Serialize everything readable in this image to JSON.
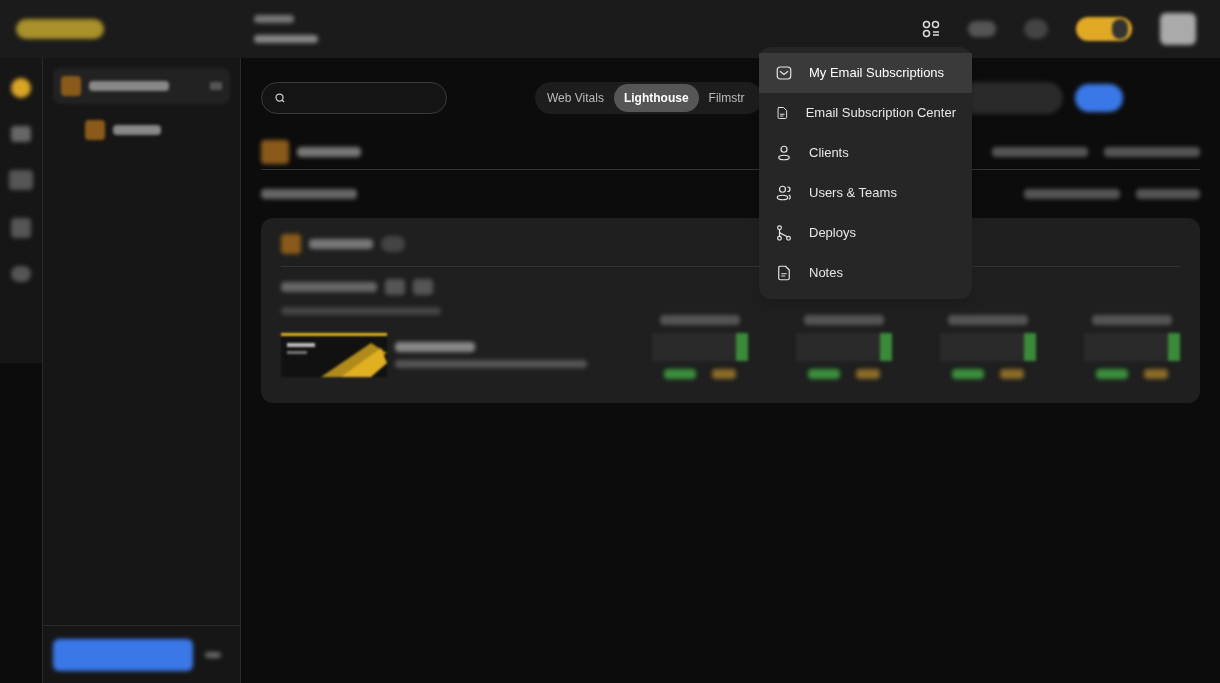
{
  "tabs": [
    {
      "label": "Web Vitals",
      "selected": false
    },
    {
      "label": "Lighthouse",
      "selected": true
    },
    {
      "label": "Filmstr",
      "selected": false
    }
  ],
  "theme_toggle": {
    "on": true
  },
  "menu": {
    "items": [
      {
        "label": "My Email Subscriptions",
        "kind": "mail",
        "selected": true
      },
      {
        "label": "Email Subscription Center",
        "kind": "doc",
        "selected": false
      },
      {
        "label": "Clients",
        "kind": "person",
        "selected": false
      },
      {
        "label": "Users & Teams",
        "kind": "people",
        "selected": false
      },
      {
        "label": "Deploys",
        "kind": "branch",
        "selected": false
      },
      {
        "label": "Notes",
        "kind": "note",
        "selected": false
      }
    ]
  }
}
